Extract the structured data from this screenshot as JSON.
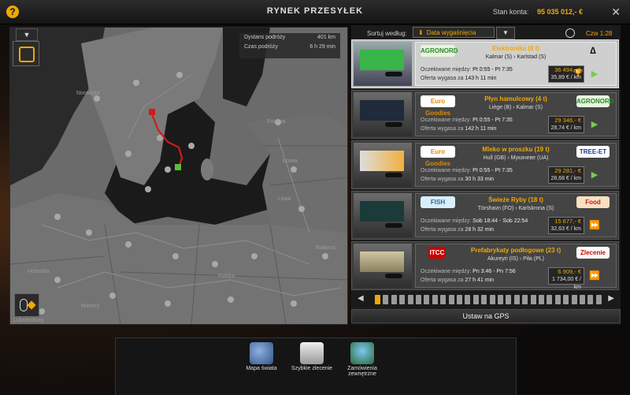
{
  "header": {
    "title": "RYNEK PRZESYŁEK",
    "balance_label": "Stan konta:",
    "balance_value": "95 035 012,- €",
    "help": "?",
    "close": "✕"
  },
  "map": {
    "collapse": "▼",
    "distance_label": "Dystans podróży",
    "distance_value": "401 km",
    "time_label": "Czas podróży",
    "time_value": "6 h 29 min",
    "labels": [
      "Norwegia",
      "Estonia",
      "Łotwa",
      "Litwa",
      "Białoruś",
      "Polska",
      "Niemcy",
      "Holandia",
      "Luksemburg"
    ]
  },
  "sort": {
    "label": "Sortuj według:",
    "value": "Data wygaśnięcia",
    "time": "Czw 1:28"
  },
  "jobs": [
    {
      "cargo": "Elektronika (8 t)",
      "route": "Kalmar (S)  ›  Karlstad (S)",
      "wait_label": "Oczekiwane między:",
      "wait": "Pt 0:55 - Pt 7:35",
      "expire_label": "Oferta wygasa za",
      "expire": "143 h 11 min",
      "price": "36 494,- €",
      "per_km": "35,89 € / km",
      "logo_left": "AGRONORD",
      "logo_right": "∆",
      "selected": true
    },
    {
      "cargo": "Płyn hamulcowy (4 t)",
      "route": "Liège (B)  ›  Kalmar (S)",
      "wait_label": "Oczekiwane między:",
      "wait": "Pt 0:55 - Pt 7:35",
      "expire_label": "Oferta wygasa za",
      "expire": "142 h 11 min",
      "price": "29 346,- €",
      "per_km": "28,74 € / km",
      "logo_left": "Euro Goodies",
      "logo_right": "AGRONORD"
    },
    {
      "cargo": "Mleko w proszku (19 t)",
      "route": "Hull (GB)  ›  Мукачеве (UA)",
      "wait_label": "Oczekiwane między:",
      "wait": "Pt 0:55 - Pt 7:35",
      "expire_label": "Oferta wygasa za",
      "expire": "30 h 33 min",
      "price": "29 281,- €",
      "per_km": "28,68 € / km",
      "logo_left": "Euro Goodies",
      "logo_right": "TREE-ET"
    },
    {
      "cargo": "Świeże Ryby (18 t)",
      "route": "Tórshavn (FO)  ›  Karlskrona (S)",
      "wait_label": "Oczekiwane między:",
      "wait": "Sob 18:44 - Sob 22:54",
      "expire_label": "Oferta wygasa za",
      "expire": "28 h 32 min",
      "price": "15 677,- €",
      "per_km": "32,63 € / km",
      "logo_left": "FISH",
      "logo_right": "Food"
    },
    {
      "cargo": "Prefabrykaty podłogowe (23 t)",
      "route": "Akureyri (IS)  ›  Piła (PL)",
      "wait_label": "Oczekiwane między:",
      "wait": "Pn 3:46 - Pn 7:56",
      "expire_label": "Oferta wygasa za",
      "expire": "27 h 41 min",
      "price": "6 909,- €",
      "per_km": "1 734,00 € / km",
      "logo_left": "ITCC",
      "logo_right": "Zlecenie"
    }
  ],
  "gps_button": "Ustaw na GPS",
  "bottom_nav": [
    {
      "label": "Mapa świata"
    },
    {
      "label": "Szybkie zlecenie"
    },
    {
      "label": "Zamówienia zewnętrzne"
    }
  ],
  "colors": {
    "accent": "#f2a800",
    "go_green": "#7ec850",
    "go_blue": "#4aa3ff",
    "route_red": "#d11a1a"
  }
}
